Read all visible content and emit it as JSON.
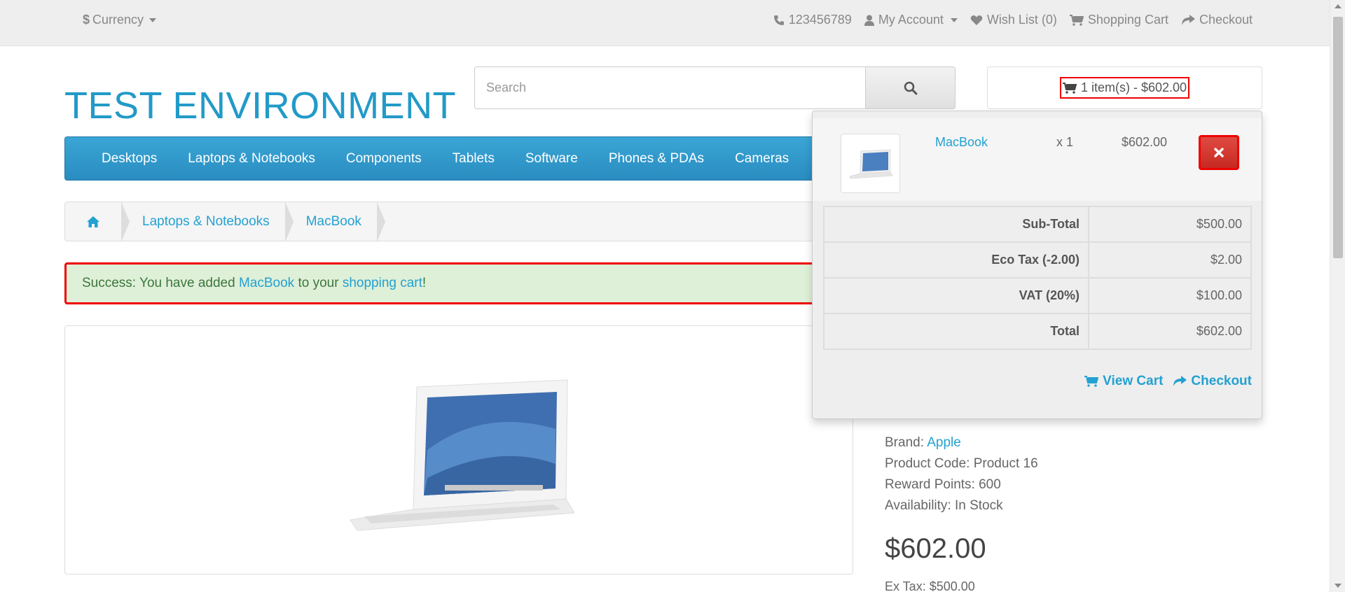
{
  "topbar": {
    "currency_symbol": "$",
    "currency_label": "Currency",
    "phone": "123456789",
    "my_account": "My Account",
    "wishlist": "Wish List (0)",
    "shopping_cart": "Shopping Cart",
    "checkout": "Checkout"
  },
  "header": {
    "logo": "TEST ENVIRONMENT",
    "search_placeholder": "Search",
    "cart_summary": "1 item(s) - $602.00"
  },
  "menu": {
    "items": [
      "Desktops",
      "Laptops & Notebooks",
      "Components",
      "Tablets",
      "Software",
      "Phones & PDAs",
      "Cameras"
    ]
  },
  "breadcrumb": {
    "items": [
      "Laptops & Notebooks",
      "MacBook"
    ]
  },
  "alert": {
    "prefix": "Success: You have added ",
    "product_link": "MacBook",
    "middle": " to your ",
    "cart_link": "shopping cart",
    "suffix": "!"
  },
  "product": {
    "brand_label": "Brand: ",
    "brand": "Apple",
    "code": "Product Code: Product 16",
    "reward": "Reward Points: 600",
    "availability": "Availability: In Stock",
    "price": "$602.00",
    "ex_tax": "Ex Tax: $500.00"
  },
  "cart_dropdown": {
    "item_name": "MacBook",
    "item_qty": "x 1",
    "item_price": "$602.00",
    "totals": [
      {
        "label": "Sub-Total",
        "value": "$500.00"
      },
      {
        "label": "Eco Tax (-2.00)",
        "value": "$2.00"
      },
      {
        "label": "VAT (20%)",
        "value": "$100.00"
      },
      {
        "label": "Total",
        "value": "$602.00"
      }
    ],
    "view_cart": "View Cart",
    "checkout": "Checkout"
  },
  "colors": {
    "accent": "#23a1d1",
    "menu": "#2a8cc0",
    "alert_bg": "#dff0d8",
    "highlight": "#ee0000"
  }
}
